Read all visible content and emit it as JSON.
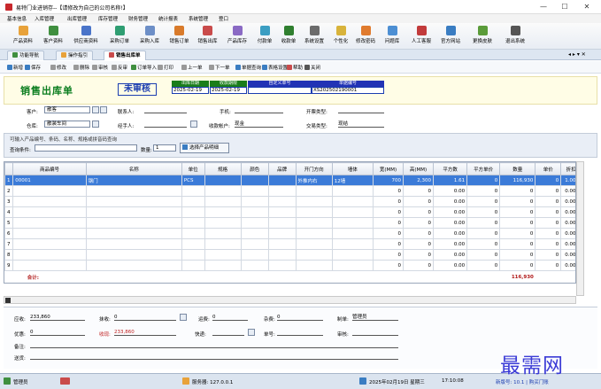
{
  "window": {
    "title": "易特门业进销存--【请修改为自己的公司名称!】",
    "minimize": "—",
    "maximize": "☐",
    "close": "✕"
  },
  "menu": [
    "基本信息",
    "入库管理",
    "出库管理",
    "库存管理",
    "财务管理",
    "统计报表",
    "系统管理",
    "登口"
  ],
  "toolbar": [
    {
      "label": "产品资料",
      "color": "#e8a23a"
    },
    {
      "label": "客户资料",
      "color": "#3f8f3f"
    },
    {
      "label": "供应商资料",
      "color": "#4a74c9"
    },
    {
      "label": "采购订单",
      "color": "#2f9e72"
    },
    {
      "label": "采购入库",
      "color": "#6d8fc7"
    },
    {
      "label": "销售订单",
      "color": "#d97b2b"
    },
    {
      "label": "销售出库",
      "color": "#c94b4b"
    },
    {
      "label": "产品库存",
      "color": "#8a6ac4"
    },
    {
      "label": "付款单",
      "color": "#3c9ec2"
    },
    {
      "label": "收款单",
      "color": "#2f7f2f"
    },
    {
      "label": "系统设置",
      "color": "#6c6c6c"
    },
    {
      "label": "个性化",
      "color": "#d8b33b"
    },
    {
      "label": "修改密码",
      "color": "#e07b2e"
    },
    {
      "label": "问题库",
      "color": "#4d8fd3"
    },
    {
      "label": "人工客服",
      "color": "#c23b3b"
    },
    {
      "label": "官方网站",
      "color": "#3a7dc2"
    },
    {
      "label": "更换皮肤",
      "color": "#5b9c3a"
    },
    {
      "label": "退出系统",
      "color": "#555555"
    }
  ],
  "tabs": [
    {
      "label": "功能导航",
      "color": "#3f8f3f",
      "active": false
    },
    {
      "label": "操作指引",
      "color": "#e8a23a",
      "active": false
    },
    {
      "label": "销售出库单",
      "color": "#c94b4b",
      "active": true
    }
  ],
  "tabbar_controls": "◂ ▸ ▾ ✕",
  "subtoolbar": [
    {
      "label": "新增",
      "color": "#3a7dc2"
    },
    {
      "label": "保存",
      "color": "#3a7dc2"
    },
    {
      "label": "修改",
      "color": "#999999"
    },
    {
      "label": "删除",
      "color": "#999999"
    },
    {
      "label": "审核",
      "color": "#999999"
    },
    {
      "label": "反审",
      "color": "#999999"
    },
    {
      "label": "订单导入",
      "color": "#3f8f3f"
    },
    {
      "label": "打印",
      "color": "#999999"
    },
    {
      "label": "上一单",
      "color": "#999999"
    },
    {
      "label": "下一单",
      "color": "#999999"
    },
    {
      "label": "单据查询",
      "color": "#3a7dc2"
    },
    {
      "label": "表格设置",
      "color": "#3a7dc2"
    },
    {
      "label": "帮助",
      "color": "#c94b4b"
    },
    {
      "label": "关闭",
      "color": "#555555"
    }
  ],
  "header": {
    "title": "销售出库单",
    "status": "未审核",
    "cols": [
      {
        "h": "出库日期",
        "v": "2025-02-19"
      },
      {
        "h": "收款期限",
        "v": "2025-02-19"
      },
      {
        "h": "自定义单号",
        "v": ""
      },
      {
        "h": "单据编号",
        "v": "XS202502190001"
      }
    ]
  },
  "form": {
    "customer_label": "客户:",
    "customer": "散客",
    "contact_label": "联系人:",
    "contact": "",
    "phone_label": "手机:",
    "phone": "",
    "invoice_label": "开票类型:",
    "invoice": "",
    "warehouse_label": "仓库:",
    "warehouse": "散装车间",
    "handler_label": "经手人:",
    "handler": "",
    "account_label": "收款帐户:",
    "account": "现金",
    "trade_label": "交易类型:",
    "trade": "现结"
  },
  "search": {
    "hint": "可输入产品编号、条码、名称、规格或拼音码查询",
    "query_label": "查询条件:",
    "query": "",
    "qty_label": "数量:",
    "qty": "1",
    "select_btn": "选择产品明细"
  },
  "grid": {
    "columns": [
      "",
      "商品编号",
      "名称",
      "单位",
      "规格",
      "颜色",
      "品牌",
      "开门方向",
      "墙体",
      "宽(MM)",
      "高(MM)",
      "平方数",
      "平方单价",
      "数量",
      "单价",
      "折扣"
    ],
    "rows": [
      [
        "1",
        "00001",
        "钢门",
        "PCS",
        "",
        "",
        "",
        "外推内右",
        "12墙",
        "700",
        "2,300",
        "1.61",
        "0",
        "116,930",
        "0",
        "1.000"
      ],
      [
        "2",
        "",
        "",
        "",
        "",
        "",
        "",
        "",
        "",
        "0",
        "0",
        "0.00",
        "0",
        "0",
        "0",
        "0.000"
      ],
      [
        "3",
        "",
        "",
        "",
        "",
        "",
        "",
        "",
        "",
        "0",
        "0",
        "0.00",
        "0",
        "0",
        "0",
        "0.000"
      ],
      [
        "4",
        "",
        "",
        "",
        "",
        "",
        "",
        "",
        "",
        "0",
        "0",
        "0.00",
        "0",
        "0",
        "0",
        "0.000"
      ],
      [
        "5",
        "",
        "",
        "",
        "",
        "",
        "",
        "",
        "",
        "0",
        "0",
        "0.00",
        "0",
        "0",
        "0",
        "0.000"
      ],
      [
        "6",
        "",
        "",
        "",
        "",
        "",
        "",
        "",
        "",
        "0",
        "0",
        "0.00",
        "0",
        "0",
        "0",
        "0.000"
      ],
      [
        "7",
        "",
        "",
        "",
        "",
        "",
        "",
        "",
        "",
        "0",
        "0",
        "0.00",
        "0",
        "0",
        "0",
        "0.000"
      ],
      [
        "8",
        "",
        "",
        "",
        "",
        "",
        "",
        "",
        "",
        "0",
        "0",
        "0.00",
        "0",
        "0",
        "0",
        "0.000"
      ],
      [
        "9",
        "",
        "",
        "",
        "",
        "",
        "",
        "",
        "",
        "0",
        "0",
        "0.00",
        "0",
        "0",
        "0",
        "0.000"
      ]
    ],
    "total_label": "合计:",
    "total_qty": "116,930"
  },
  "footer": {
    "receivable_label": "应收:",
    "receivable": "233,860",
    "discount_label": "抹收:",
    "discount": "0",
    "freight_label": "运费:",
    "freight": "0",
    "misc_label": "杂费:",
    "misc": "0",
    "maker_label": "制单:",
    "maker": "管理员",
    "preferential_label": "优惠:",
    "preferential": "0",
    "received_label": "收现:",
    "received": "233,860",
    "express_label": "快递:",
    "express": "",
    "tracking_label": "单号:",
    "tracking": "",
    "auditor_label": "审核:",
    "auditor": "",
    "remark_label": "备注:",
    "remark": "",
    "delivery_label": "送货:",
    "delivery": ""
  },
  "statusbar": {
    "user": "管理员",
    "server": "服务器: 127.0.0.1",
    "date": "2025年02月19日 星期三",
    "time": "17:10:08",
    "version": "新版号: 10.1 | 购买门账"
  },
  "watermark": "最需网"
}
